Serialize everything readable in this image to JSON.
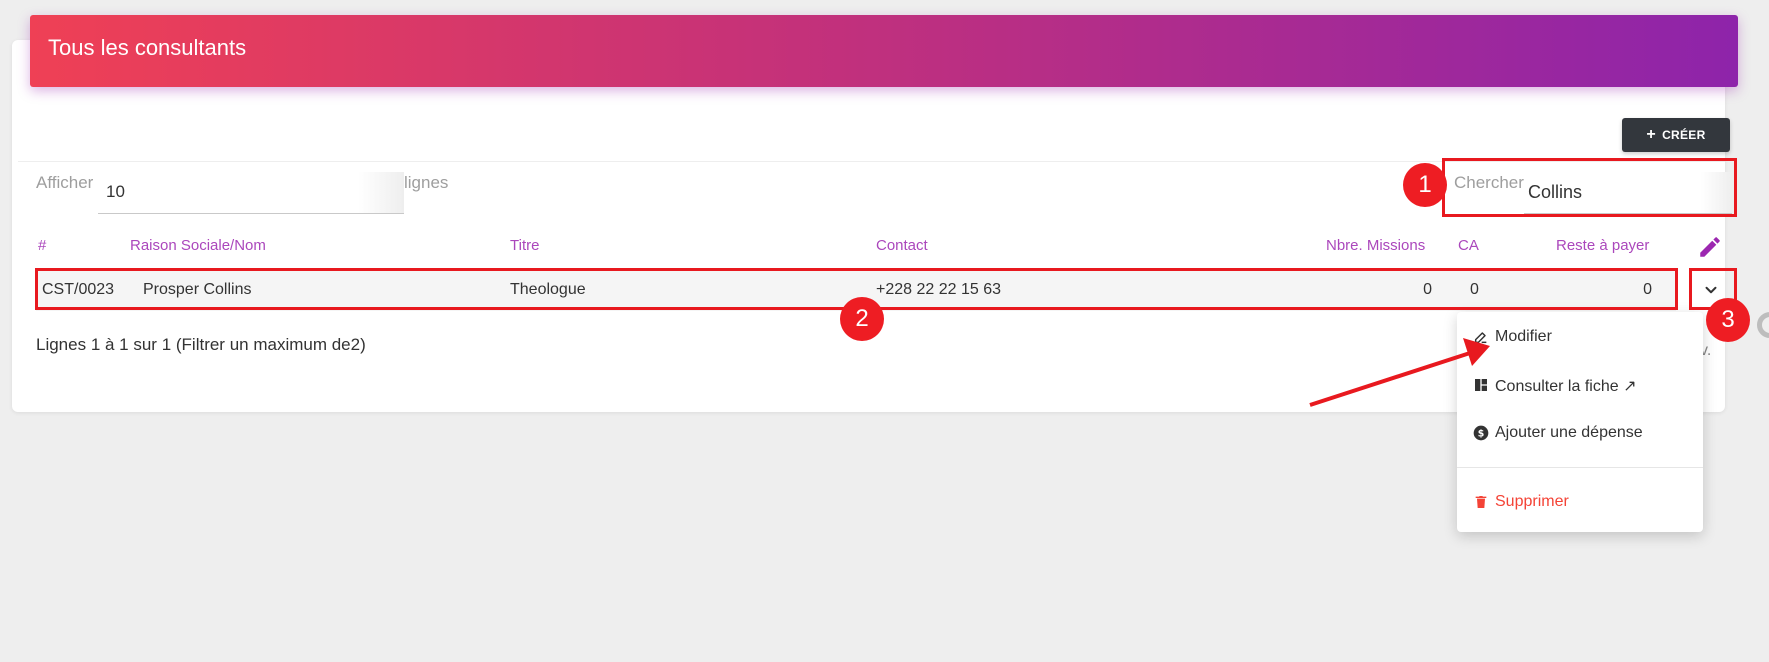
{
  "header": {
    "title": "Tous les consultants"
  },
  "toolbar": {
    "create_label": "CRÉER",
    "create_icon": "plus-icon"
  },
  "length": {
    "prefix": "Afficher",
    "value": "10",
    "suffix": "lignes"
  },
  "search": {
    "label": "Chercher:",
    "value": "Collins"
  },
  "table": {
    "columns": [
      "#",
      "Raison Sociale/Nom",
      "Titre",
      "Contact",
      "Nbre. Missions",
      "CA",
      "Reste à payer"
    ],
    "actions_icon": "pencil-icon",
    "rows": [
      {
        "id": "CST/0023",
        "name": "Prosper Collins",
        "title": "Theologue",
        "contact": "+228 22 22 15 63",
        "missions": "0",
        "ca": "0",
        "reste": "0"
      }
    ]
  },
  "footer": {
    "info": "Lignes 1 à 1 sur 1 (Filtrer un maximum de2)",
    "pager_tail": "v."
  },
  "menu": {
    "items": [
      {
        "label": "Modifier",
        "icon": "edit-pen-icon"
      },
      {
        "label": "Consulter la fiche ↗",
        "icon": "dashboard-icon"
      },
      {
        "label": "Ajouter une dépense",
        "icon": "dollar-circle-icon"
      },
      {
        "label": "Supprimer",
        "icon": "trash-icon"
      }
    ]
  },
  "annotations": {
    "badges": [
      "1",
      "2",
      "3"
    ],
    "color": "#e8191f"
  },
  "colors": {
    "header_start": "#ef4055",
    "header_end": "#8e24aa",
    "accent": "#ab47bc",
    "button_dark": "#33373d",
    "danger": "#f44336"
  }
}
